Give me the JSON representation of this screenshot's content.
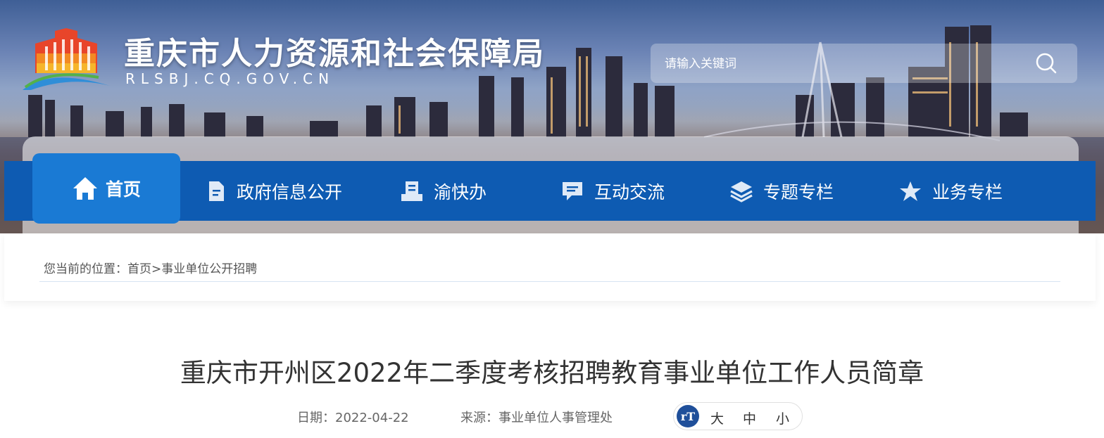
{
  "header": {
    "site_title": "重庆市人力资源和社会保障局",
    "site_domain": "RLSBJ.CQ.GOV.CN",
    "logo_icon": "government-building-logo"
  },
  "search": {
    "placeholder": "请输入关键词",
    "icon": "search-icon"
  },
  "nav": {
    "items": [
      {
        "label": "首页",
        "icon": "home-icon",
        "active": true
      },
      {
        "label": "政府信息公开",
        "icon": "document-icon"
      },
      {
        "label": "渝快办",
        "icon": "file-list-icon"
      },
      {
        "label": "互动交流",
        "icon": "chat-icon"
      },
      {
        "label": "专题专栏",
        "icon": "layers-icon"
      },
      {
        "label": "业务专栏",
        "icon": "star-icon"
      }
    ]
  },
  "breadcrumb": {
    "prefix": "您当前的位置：",
    "home": "首页",
    "separator": ">",
    "current": "事业单位公开招聘"
  },
  "article": {
    "title": "重庆市开州区2022年二季度考核招聘教育事业单位工作人员简章",
    "date_label": "日期：2022-04-22",
    "source_label": "来源：事业单位人事管理处"
  },
  "font_size": {
    "icon_text": "rT",
    "large": "大",
    "medium": "中",
    "small": "小"
  },
  "colors": {
    "nav_blue": "#0e5bb2",
    "nav_active": "#1a7ad4",
    "title_text": "#333333"
  }
}
